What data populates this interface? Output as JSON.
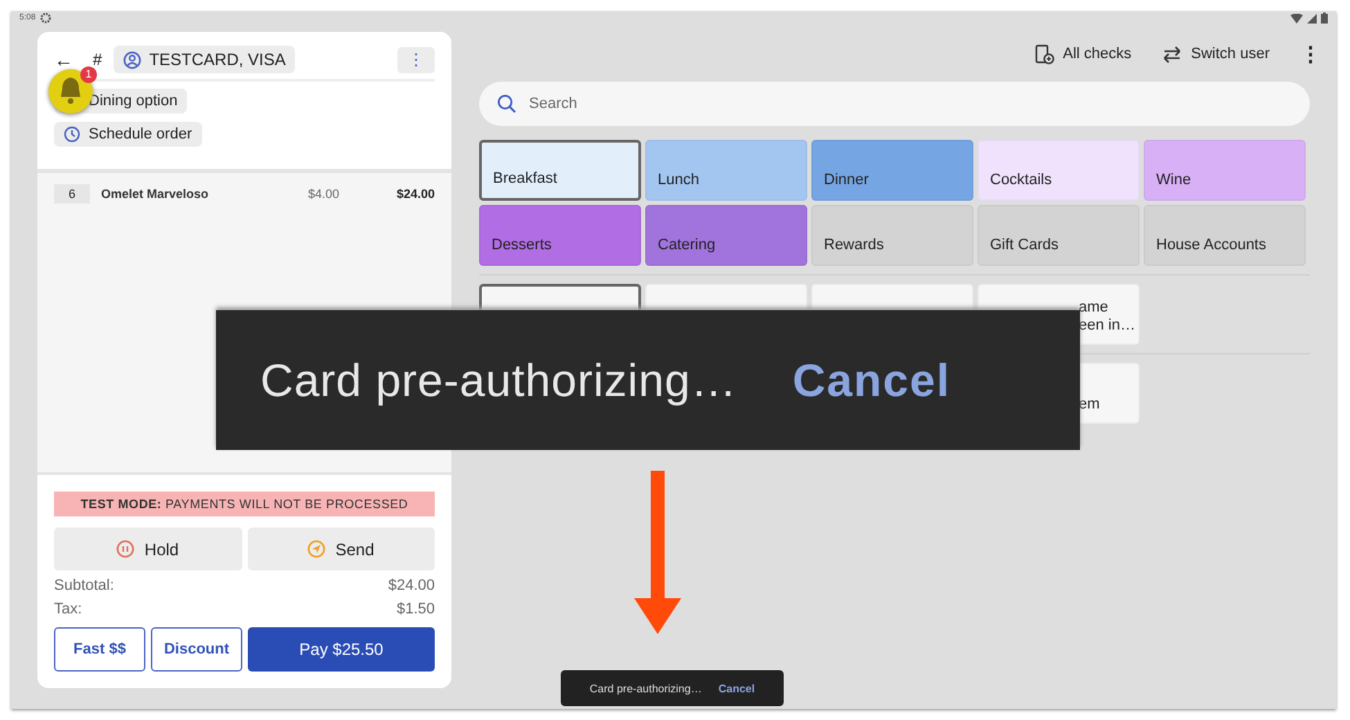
{
  "status_bar": {
    "time": "5:08"
  },
  "order_panel": {
    "back": "←",
    "hash": "#",
    "customer": "TESTCARD, VISA",
    "more": "⋮",
    "notification_count": "1",
    "chips": [
      {
        "label": "Dining option",
        "kind": "dining"
      },
      {
        "label": "Schedule order",
        "kind": "schedule"
      }
    ],
    "lines": [
      {
        "qty": "6",
        "name": "Omelet Marveloso",
        "price": "$4.00",
        "total": "$24.00"
      }
    ],
    "banner": {
      "label": "TEST MODE:",
      "text": "PAYMENTS WILL NOT BE PROCESSED"
    },
    "actions": [
      {
        "label": "Hold",
        "kind": "hold"
      },
      {
        "label": "Send",
        "kind": "send"
      }
    ],
    "totals": [
      {
        "label": "Subtotal:",
        "value": "$24.00"
      },
      {
        "label": "Tax:",
        "value": "$1.50"
      }
    ],
    "buttons": [
      {
        "label": "Fast $$",
        "kind": "outline"
      },
      {
        "label": "Discount",
        "kind": "outline"
      },
      {
        "label": "Pay $25.50",
        "kind": "primary"
      }
    ]
  },
  "toolbar": {
    "items": [
      {
        "label": "All checks",
        "kind": "checks"
      },
      {
        "label": "Switch user",
        "kind": "switch"
      }
    ],
    "more": "⋮"
  },
  "search": {
    "placeholder": "Search"
  },
  "categories": [
    {
      "label": "Breakfast",
      "color": "#e3eefb",
      "selected": true
    },
    {
      "label": "Lunch",
      "color": "#a3c6f1",
      "selected": false
    },
    {
      "label": "Dinner",
      "color": "#76a5e3",
      "selected": false
    },
    {
      "label": "Cocktails",
      "color": "#f0e2fc",
      "selected": false
    },
    {
      "label": "Wine",
      "color": "#d8b0f6",
      "selected": false
    },
    {
      "label": "Desserts",
      "color": "#b16de3",
      "selected": false
    },
    {
      "label": "Catering",
      "color": "#a173dc",
      "selected": false
    },
    {
      "label": "Rewards",
      "color": "#d3d3d3",
      "selected": false
    },
    {
      "label": "Gift Cards",
      "color": "#d3d3d3",
      "selected": false
    },
    {
      "label": "House Accounts",
      "color": "#d3d3d3",
      "selected": false
    }
  ],
  "item_rows": [
    [
      {
        "selected": true
      },
      {
        "selected": false
      },
      {
        "selected": false
      },
      {
        "selected": false,
        "lines": [
          "ame",
          "een in…"
        ]
      }
    ],
    [
      {
        "selected": false,
        "lines": [
          "em"
        ]
      }
    ]
  ],
  "callout": {
    "text": "Card pre-authorizing…",
    "action": "Cancel"
  },
  "toast": {
    "text": "Card pre-authorizing…",
    "action": "Cancel"
  }
}
